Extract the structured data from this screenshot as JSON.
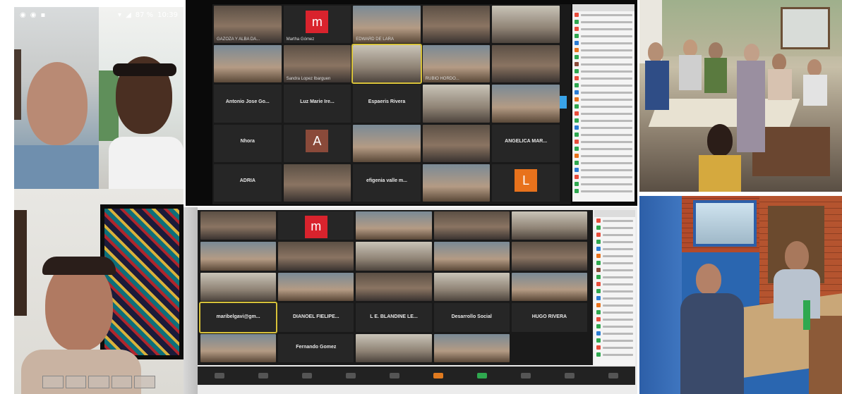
{
  "phone_call": {
    "status_icons": [
      "whatsapp-icon",
      "facebook-icon",
      "video-icon"
    ],
    "battery": "87 %",
    "time": "10:39"
  },
  "zoom_top": {
    "rows": [
      [
        {
          "name": "GAZOZA Y ALBA DA...",
          "kind": "video"
        },
        {
          "name": "Martha Gómez",
          "kind": "avatar",
          "letter": "m",
          "color": "#d9232d"
        },
        {
          "name": "EDWARD DE LARA",
          "kind": "video"
        },
        {
          "name": "",
          "kind": "video"
        },
        {
          "name": "",
          "kind": "video"
        }
      ],
      [
        {
          "name": "",
          "kind": "video"
        },
        {
          "name": "Sandra Lopez Ibarguen",
          "kind": "video"
        },
        {
          "name": "",
          "kind": "video",
          "active": true
        },
        {
          "name": "RUBIO HORDO...",
          "kind": "video"
        },
        {
          "name": "",
          "kind": "video"
        }
      ],
      [
        {
          "name": "",
          "kind": "label",
          "label": "Antonio Jose Go..."
        },
        {
          "name": "",
          "kind": "label",
          "label": "Luz Marie Ire..."
        },
        {
          "name": "",
          "kind": "label",
          "label": "Espaeris Rivera"
        },
        {
          "name": "",
          "kind": "video"
        },
        {
          "name": "",
          "kind": "video"
        }
      ],
      [
        {
          "name": "",
          "kind": "label",
          "label": "Nhora"
        },
        {
          "name": "",
          "kind": "avatar",
          "letter": "A",
          "color": "#8a4a3a"
        },
        {
          "name": "",
          "kind": "video"
        },
        {
          "name": "",
          "kind": "video"
        },
        {
          "name": "",
          "kind": "label",
          "label": "ANGELICA MAR..."
        }
      ],
      [
        {
          "name": "",
          "kind": "label",
          "label": "ADRIA"
        },
        {
          "name": "",
          "kind": "video"
        },
        {
          "name": "",
          "kind": "label",
          "label": "efigenia valle m..."
        },
        {
          "name": "",
          "kind": "video"
        },
        {
          "name": "",
          "kind": "avatar",
          "letter": "L",
          "color": "#e8721c"
        }
      ]
    ]
  },
  "zoom_bottom": {
    "rows": [
      [
        {
          "name": "",
          "kind": "video"
        },
        {
          "name": "",
          "kind": "avatar",
          "letter": "m",
          "color": "#d9232d"
        },
        {
          "name": "",
          "kind": "video"
        },
        {
          "name": "",
          "kind": "video"
        },
        {
          "name": "",
          "kind": "video"
        }
      ],
      [
        {
          "name": "",
          "kind": "video"
        },
        {
          "name": "",
          "kind": "video"
        },
        {
          "name": "",
          "kind": "video"
        },
        {
          "name": "",
          "kind": "video"
        },
        {
          "name": "",
          "kind": "video"
        }
      ],
      [
        {
          "name": "",
          "kind": "video"
        },
        {
          "name": "",
          "kind": "video"
        },
        {
          "name": "",
          "kind": "video"
        },
        {
          "name": "",
          "kind": "video"
        },
        {
          "name": "",
          "kind": "video"
        }
      ],
      [
        {
          "name": "",
          "kind": "label",
          "label": "maribelgavi@gm...",
          "active": true
        },
        {
          "name": "",
          "kind": "label",
          "label": "DIANOEL FIELIPE..."
        },
        {
          "name": "",
          "kind": "label",
          "label": "L E. BLANDINE LE..."
        },
        {
          "name": "",
          "kind": "label",
          "label": "Desarrollo Social"
        },
        {
          "name": "",
          "kind": "label",
          "label": "HUGO RIVERA"
        }
      ],
      [
        {
          "name": "",
          "kind": "video"
        },
        {
          "name": "",
          "kind": "label",
          "label": "Fernando Gomez"
        },
        {
          "name": "",
          "kind": "video"
        },
        {
          "name": "",
          "kind": "video"
        }
      ]
    ]
  },
  "sidebar_colors": [
    "#e84d3c",
    "#2fa84f",
    "#e84d3c",
    "#2fa84f",
    "#2b7cd3",
    "#e8721c",
    "#2fa84f",
    "#8a4a3a",
    "#2fa84f",
    "#e84d3c",
    "#2fa84f",
    "#2b7cd3",
    "#e8721c",
    "#2fa84f",
    "#e84d3c",
    "#2fa84f",
    "#2b7cd3",
    "#2fa84f",
    "#e84d3c",
    "#2fa84f",
    "#e8721c",
    "#2fa84f",
    "#2b7cd3",
    "#e84d3c",
    "#2fa84f",
    "#2fa84f"
  ]
}
